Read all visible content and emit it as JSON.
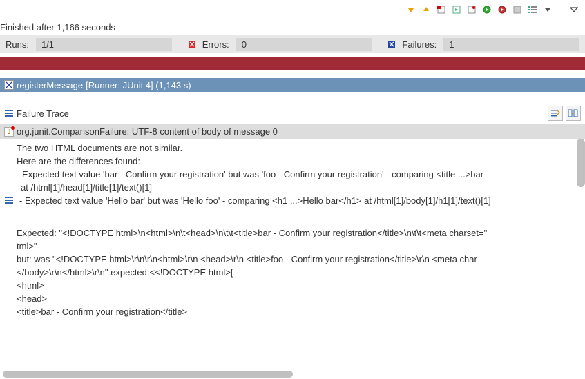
{
  "toolbar": {
    "icons": [
      "arrow-down",
      "arrow-up",
      "stop",
      "rerun",
      "rerun-failed",
      "run-green",
      "run-red",
      "gray-square",
      "list-checks",
      "dropdown",
      "menu"
    ]
  },
  "finished_text": "Finished after 1,166 seconds",
  "stats": {
    "runs_label": "Runs:",
    "runs_value": "1/1",
    "errors_label": "Errors:",
    "errors_value": "0",
    "failures_label": "Failures:",
    "failures_value": "1"
  },
  "test_row": {
    "name": "registerMessage",
    "meta": "[Runner: JUnit 4] (1,143 s)"
  },
  "failure_header": "Failure Trace",
  "trace": {
    "title_line": "org.junit.ComparisonFailure: UTF-8 content of body of message 0",
    "line2": "The two HTML documents are not similar.",
    "line3": "Here are the differences found:",
    "line4": " - Expected text value 'bar - Confirm your registration' but was 'foo - Confirm your registration' - comparing <title ...>bar -",
    "line4b": "at /html[1]/head[1]/title[1]/text()[1]",
    "line5": " - Expected text value 'Hello bar' but was 'Hello foo' - comparing <h1 ...>Hello bar</h1> at /html[1]/body[1]/h1[1]/text()[1]",
    "line6": "Expected: \"<!DOCTYPE html>\\n<html>\\n\\t<head>\\n\\t\\t<title>bar - Confirm your registration</title>\\n\\t\\t<meta charset=\"",
    "line6b": "tml>\"",
    "line7": "   but: was \"<!DOCTYPE html>\\r\\n\\r\\n<html>\\r\\n <head>\\r\\n  <title>foo - Confirm your registration</title>\\r\\n  <meta char",
    "line7b": " </body>\\r\\n</html>\\r\\n\" expected:<<!DOCTYPE html>[",
    "line8": "<html>",
    "line9": " <head>",
    "line10": "  <title>bar - Confirm your registration</title>"
  }
}
